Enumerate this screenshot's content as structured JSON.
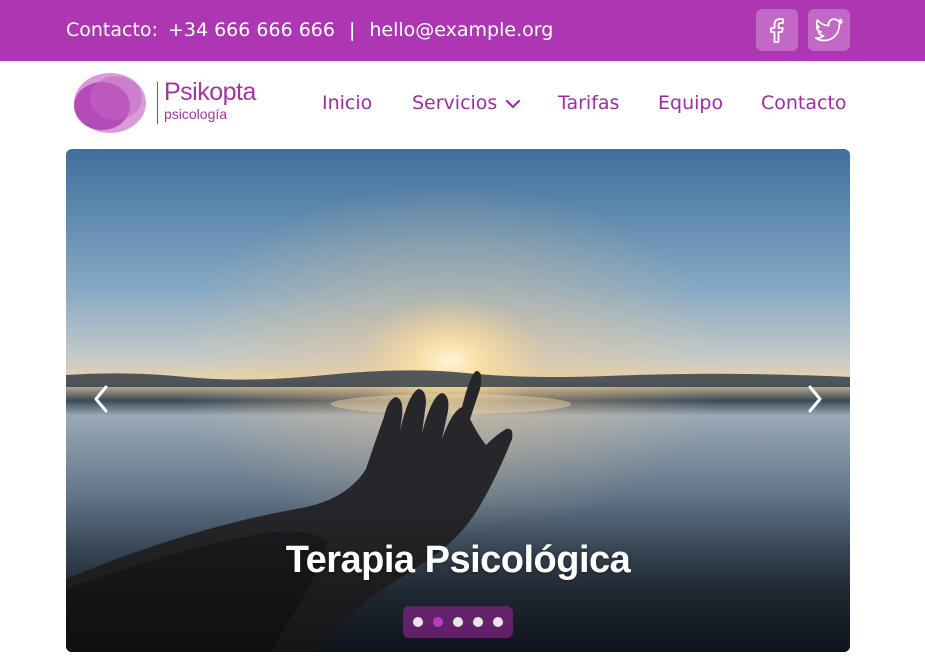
{
  "topbar": {
    "contact_label": "Contacto:",
    "phone": "+34 666 666 666",
    "separator": "|",
    "email": "hello@example.org",
    "social": [
      {
        "name": "facebook-icon"
      },
      {
        "name": "twitter-icon"
      }
    ]
  },
  "header": {
    "logo_word": "Psikopta",
    "logo_sub": "psicología"
  },
  "nav": {
    "items": [
      {
        "label": "Inicio"
      },
      {
        "label": "Servicios",
        "dropdown": true
      },
      {
        "label": "Tarifas"
      },
      {
        "label": "Equipo"
      },
      {
        "label": "Contacto"
      }
    ]
  },
  "hero": {
    "title": "Terapia Psicológica",
    "slide_count": 5,
    "active_slide": 2
  },
  "colors": {
    "brand": "#ad37b2",
    "nav_text": "#9b2fa0",
    "dot_active": "#b83cbc"
  }
}
